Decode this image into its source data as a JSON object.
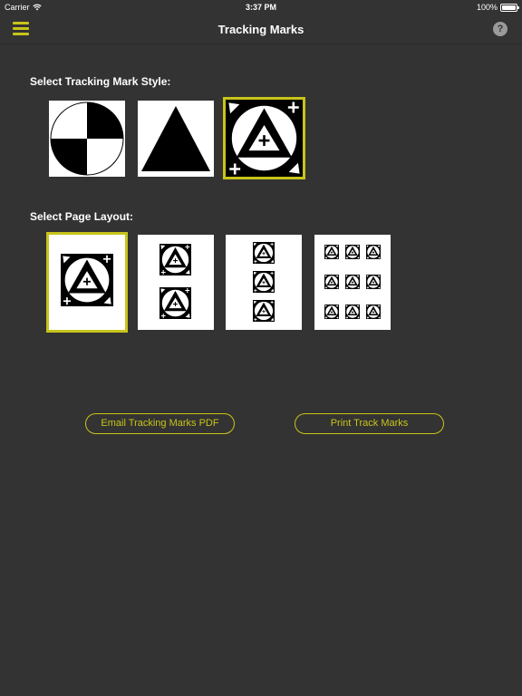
{
  "status": {
    "carrier": "Carrier",
    "time": "3:37 PM",
    "battery": "100%"
  },
  "nav": {
    "title": "Tracking Marks",
    "menu_icon": "hamburger-menu-icon",
    "help_icon": "question-mark-icon",
    "help_glyph": "?"
  },
  "style_section": {
    "label": "Select Tracking Mark Style:",
    "options": [
      {
        "name": "checker-circle",
        "selected": false
      },
      {
        "name": "triangle",
        "selected": false
      },
      {
        "name": "triangle-in-circle-crosshair",
        "selected": true
      }
    ]
  },
  "layout_section": {
    "label": "Select Page Layout:",
    "options": [
      {
        "name": "one-per-page",
        "count": 1,
        "selected": true
      },
      {
        "name": "two-per-page",
        "count": 2,
        "selected": false
      },
      {
        "name": "three-per-page",
        "count": 3,
        "selected": false
      },
      {
        "name": "nine-per-page",
        "count": 9,
        "selected": false
      }
    ]
  },
  "buttons": {
    "email_label": "Email Tracking Marks PDF",
    "print_label": "Print Track Marks"
  },
  "colors": {
    "accent": "#c8c41a",
    "background": "#333333"
  }
}
